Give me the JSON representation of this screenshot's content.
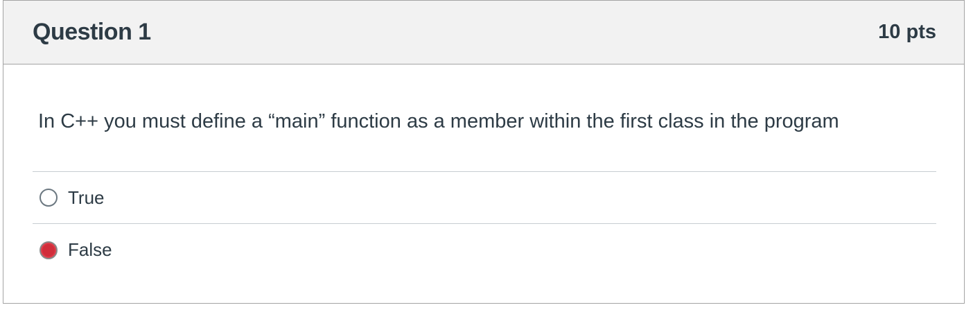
{
  "question": {
    "title": "Question 1",
    "points": "10 pts",
    "text": "In C++ you must define a “main” function as a member within the first class in the program",
    "answers": [
      {
        "label": "True",
        "selected": false
      },
      {
        "label": "False",
        "selected": true
      }
    ]
  },
  "colors": {
    "header_bg": "#f2f2f2",
    "text": "#2d3b45",
    "selected_radio": "#d12e3b",
    "border": "#a3a3a3"
  }
}
